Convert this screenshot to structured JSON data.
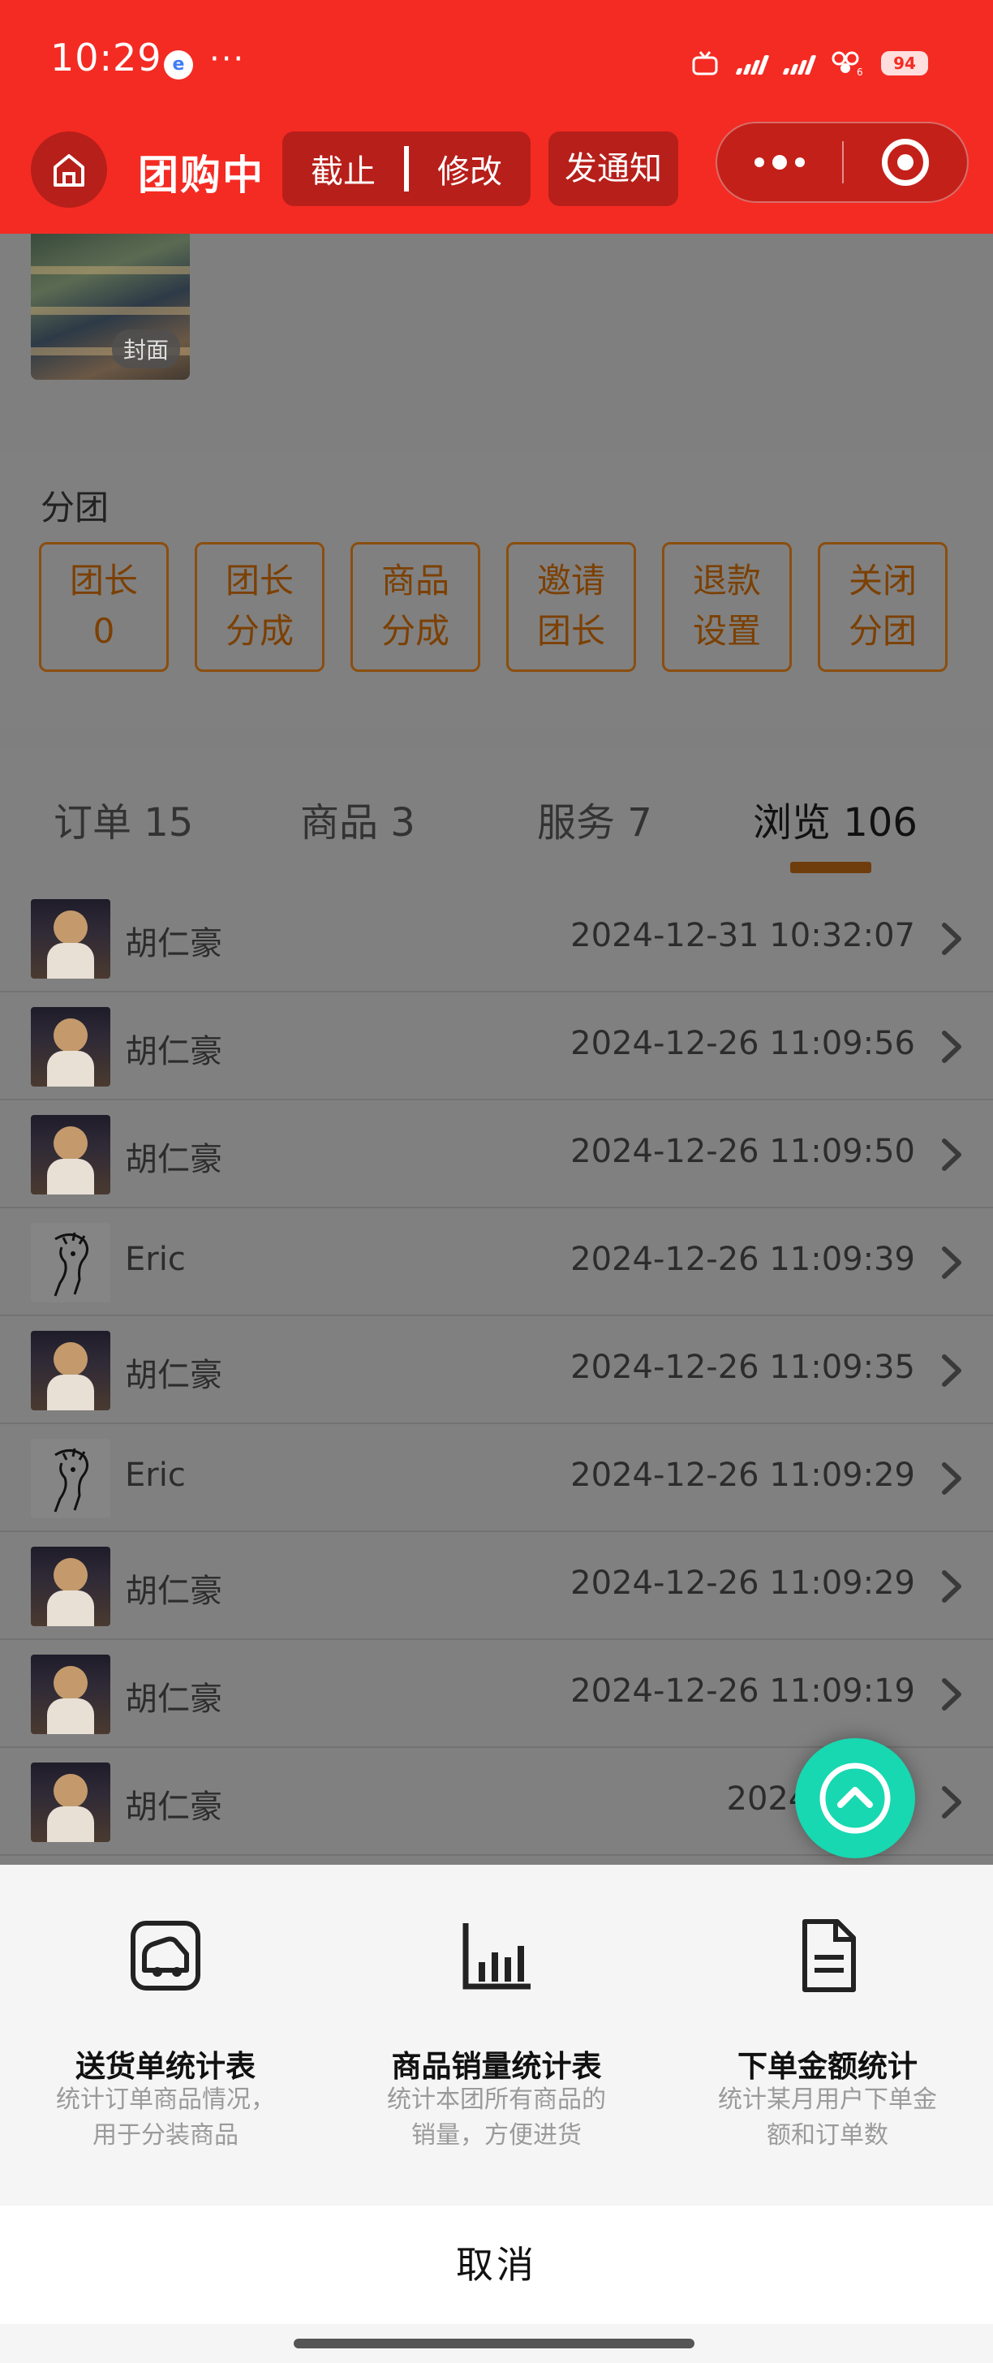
{
  "status_bar": {
    "time": "10:29",
    "more": "···",
    "battery": "94"
  },
  "nav": {
    "title": "团购中",
    "end_label": "截止",
    "edit_label": "修改",
    "notify_label": "发通知"
  },
  "cover": {
    "badge": "封面"
  },
  "fentuan": {
    "title": "分团",
    "buttons": [
      {
        "line1": "团长",
        "line2": "0"
      },
      {
        "line1": "团长",
        "line2": "分成"
      },
      {
        "line1": "商品",
        "line2": "分成"
      },
      {
        "line1": "邀请",
        "line2": "团长"
      },
      {
        "line1": "退款",
        "line2": "设置"
      },
      {
        "line1": "关闭",
        "line2": "分团"
      }
    ]
  },
  "tabs": [
    {
      "label": "订单 15"
    },
    {
      "label": "商品 3"
    },
    {
      "label": "服务 7"
    },
    {
      "label": "浏览 106"
    }
  ],
  "browse_list": [
    {
      "name": "胡仁豪",
      "time": "2024-12-31 10:32:07",
      "avatar": "photo"
    },
    {
      "name": "胡仁豪",
      "time": "2024-12-26 11:09:56",
      "avatar": "photo"
    },
    {
      "name": "胡仁豪",
      "time": "2024-12-26 11:09:50",
      "avatar": "photo"
    },
    {
      "name": "Eric",
      "time": "2024-12-26 11:09:39",
      "avatar": "sketch"
    },
    {
      "name": "胡仁豪",
      "time": "2024-12-26 11:09:35",
      "avatar": "photo"
    },
    {
      "name": "Eric",
      "time": "2024-12-26 11:09:29",
      "avatar": "sketch"
    },
    {
      "name": "胡仁豪",
      "time": "2024-12-26 11:09:29",
      "avatar": "photo"
    },
    {
      "name": "胡仁豪",
      "time": "2024-12-26 11:09:19",
      "avatar": "photo"
    },
    {
      "name": "胡仁豪",
      "time": "2024-12-26",
      "avatar": "photo"
    }
  ],
  "sheet": {
    "options": [
      {
        "title": "送货单统计表",
        "desc": "统计订单商品情况，用于分装商品",
        "icon": "delivery-truck-icon"
      },
      {
        "title": "商品销量统计表",
        "desc": "统计本团所有商品的销量，方便进货",
        "icon": "bar-chart-icon"
      },
      {
        "title": "下单金额统计",
        "desc": "统计某月用户下单金额和订单数",
        "icon": "document-icon"
      }
    ],
    "cancel_label": "取消"
  },
  "colors": {
    "brand_red": "#f42b23",
    "accent_teal": "#17d8b1",
    "accent_orange": "#d97a14"
  }
}
